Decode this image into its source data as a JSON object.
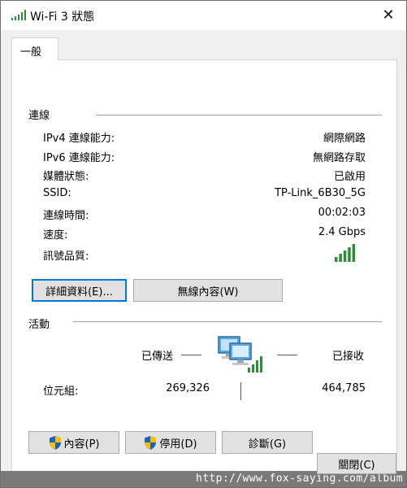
{
  "window": {
    "title": "Wi-Fi 3 狀態",
    "close_glyph": "✕"
  },
  "tabs": [
    {
      "label": "一般",
      "selected": true
    }
  ],
  "connection": {
    "section_label": "連線",
    "rows": [
      {
        "label": "IPv4 連線能力:",
        "value": "網際網路"
      },
      {
        "label": "IPv6 連線能力:",
        "value": "無網路存取"
      },
      {
        "label": "媒體狀態:",
        "value": "已啟用"
      },
      {
        "label": "SSID:",
        "value": "TP-Link_6B30_5G"
      },
      {
        "label": "連線時間:",
        "value": "00:02:03"
      },
      {
        "label": "速度:",
        "value": "2.4 Gbps"
      }
    ],
    "signal_label": "訊號品質:",
    "signal_bars": 5,
    "signal_bars_max": 5,
    "details_button": "詳細資料(E)...",
    "wireless_button": "無線內容(W)"
  },
  "activity": {
    "section_label": "活動",
    "sent_label": "已傳送",
    "received_label": "已接收",
    "bytes_label": "位元組:",
    "bytes_sent": "269,326",
    "bytes_received": "464,785"
  },
  "actions": {
    "properties": "內容(P)",
    "disable": "停用(D)",
    "diagnose": "診斷(G)",
    "close": "關閉(C)"
  },
  "footer": {
    "watermark": "http://www.fox-saying.com/album"
  },
  "colors": {
    "signal_green": "#2e8b3a",
    "focus_blue": "#0078d7",
    "shield_blue": "#1f5fbf",
    "shield_yellow": "#f2c200"
  }
}
